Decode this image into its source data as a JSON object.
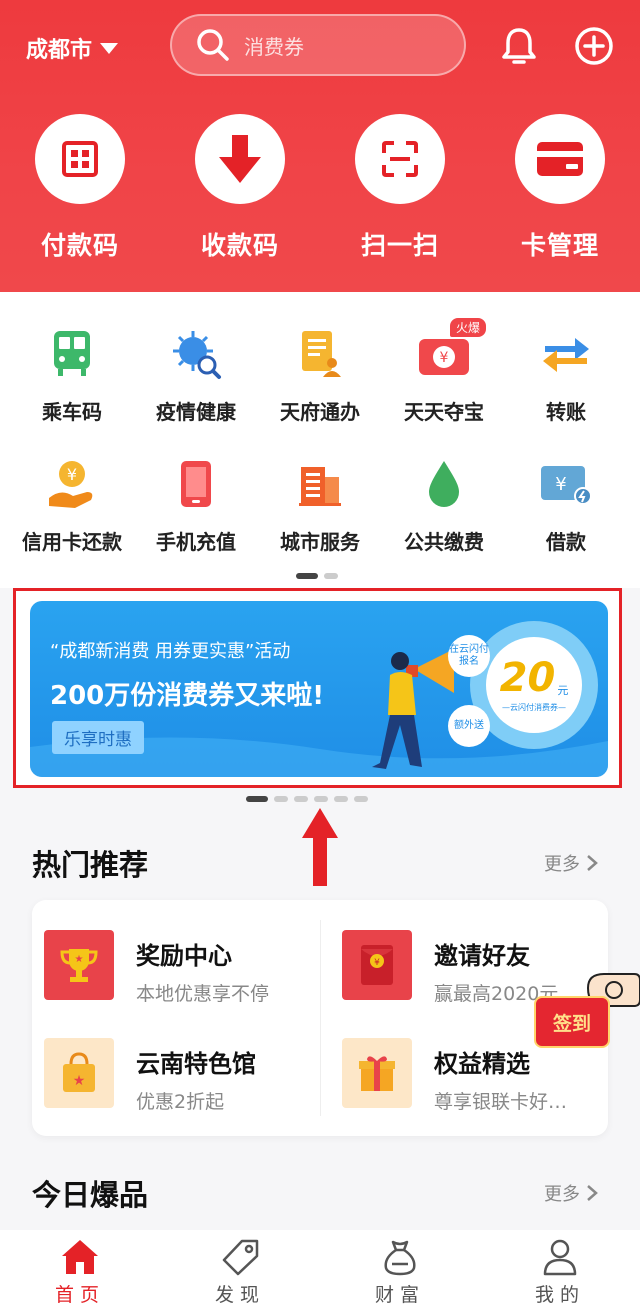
{
  "header": {
    "city": "成都市",
    "search_placeholder": "消费券",
    "quick_actions": [
      {
        "label": "付款码",
        "icon": "pay-code-icon"
      },
      {
        "label": "收款码",
        "icon": "receive-arrow-icon"
      },
      {
        "label": "扫一扫",
        "icon": "scan-icon"
      },
      {
        "label": "卡管理",
        "icon": "card-icon"
      }
    ]
  },
  "services": [
    {
      "label": "乘车码",
      "icon": "bus-icon"
    },
    {
      "label": "疫情健康",
      "icon": "virus-search-icon"
    },
    {
      "label": "天府通办",
      "icon": "document-person-icon"
    },
    {
      "label": "天天夺宝",
      "icon": "treasure-camera-icon",
      "tag": "火爆"
    },
    {
      "label": "转账",
      "icon": "transfer-arrows-icon"
    },
    {
      "label": "信用卡还款",
      "icon": "coin-hand-icon"
    },
    {
      "label": "手机充值",
      "icon": "phone-icon"
    },
    {
      "label": "城市服务",
      "icon": "building-icon"
    },
    {
      "label": "公共缴费",
      "icon": "water-drop-icon"
    },
    {
      "label": "借款",
      "icon": "yuan-card-icon"
    }
  ],
  "banner": {
    "subtitle": "“成都新消费 用券更实惠”活动",
    "title": "200万份消费券又来啦!",
    "button": "乐享时惠",
    "bubble1": "在云闪付报名",
    "bubble2": "额外送",
    "amount": "20",
    "unit": "元",
    "caption": "—云闪付消费券—"
  },
  "hot": {
    "title": "热门推荐",
    "more": "更多",
    "items": [
      {
        "title": "奖励中心",
        "subtitle": "本地优惠享不停",
        "icon": "trophy-icon"
      },
      {
        "title": "邀请好友",
        "subtitle": "赢最高2020元",
        "icon": "red-envelope-icon"
      },
      {
        "title": "云南特色馆",
        "subtitle": "优惠2折起",
        "icon": "shopping-bag-icon"
      },
      {
        "title": "权益精选",
        "subtitle": "尊享银联卡好…",
        "icon": "gift-box-icon"
      }
    ],
    "signin": "签到"
  },
  "today": {
    "title": "今日爆品",
    "more": "更多"
  },
  "tabs": [
    {
      "label": "首页",
      "icon": "home-icon",
      "active": true
    },
    {
      "label": "发现",
      "icon": "tag-icon",
      "active": false
    },
    {
      "label": "财富",
      "icon": "money-bag-icon",
      "active": false
    },
    {
      "label": "我的",
      "icon": "person-icon",
      "active": false
    }
  ],
  "colors": {
    "brand_red": "#f04448",
    "banner_blue": "#1f8ee6",
    "active_tab": "#e42227"
  }
}
